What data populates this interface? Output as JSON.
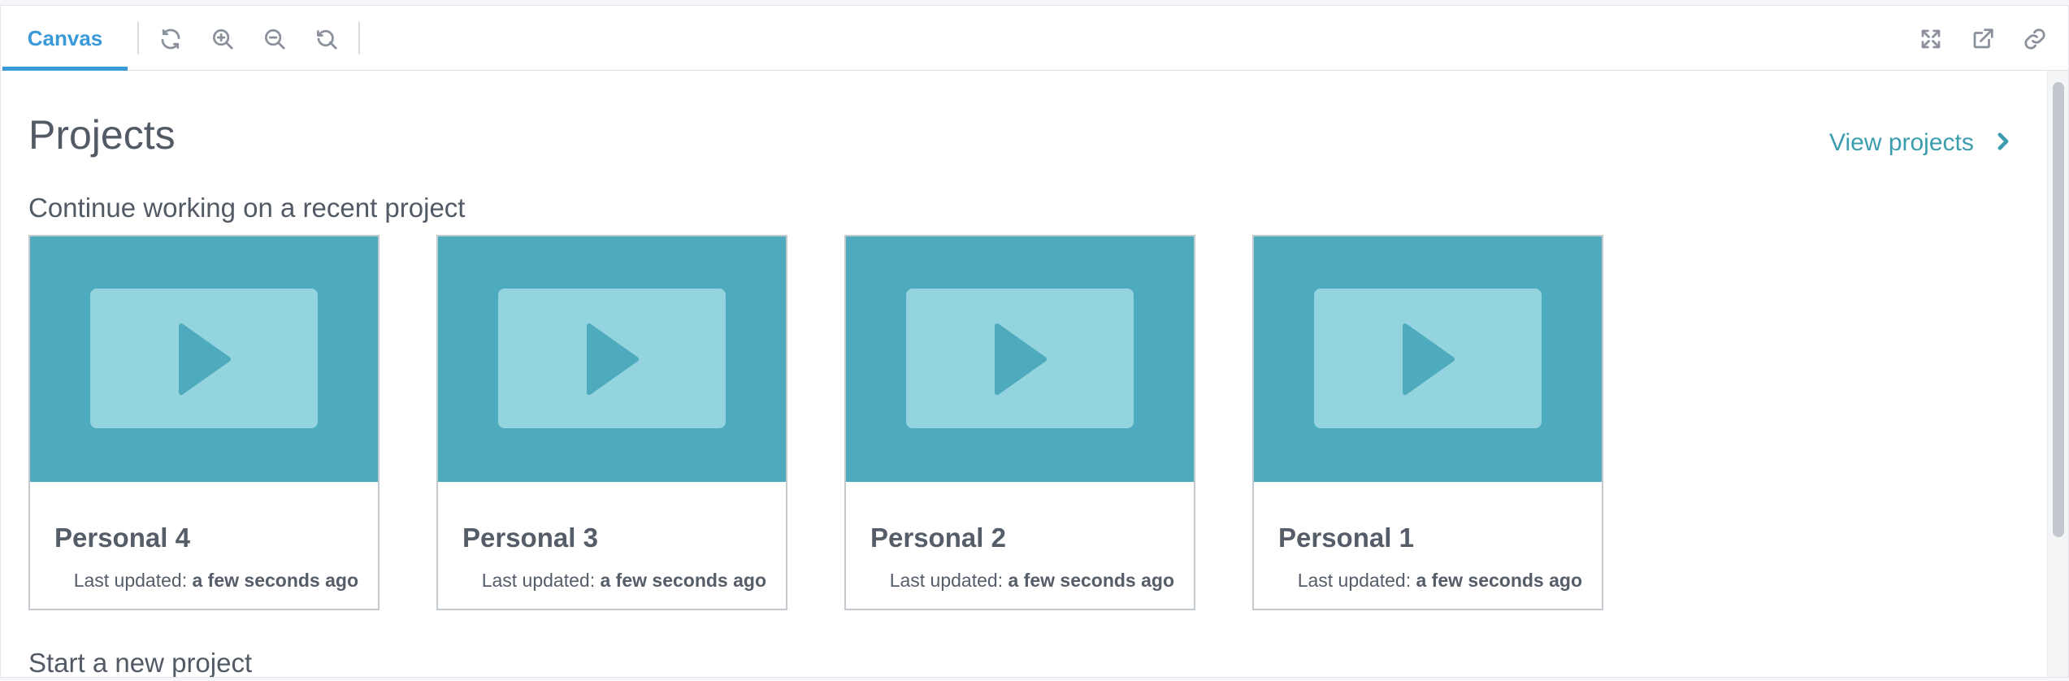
{
  "toolbar": {
    "tab_label": "Canvas",
    "left_icons": [
      "refresh-icon",
      "zoom-in-icon",
      "zoom-out-icon",
      "reset-zoom-icon"
    ],
    "right_icons": [
      "fullscreen-icon",
      "open-external-icon",
      "link-icon"
    ]
  },
  "header": {
    "title": "Projects",
    "view_projects_label": "View projects"
  },
  "sections": {
    "recent_title": "Continue working on a recent project",
    "new_title": "Start a new project"
  },
  "projects": [
    {
      "name": "Personal 4",
      "updated_label": "Last updated:",
      "updated_value": "a few seconds ago"
    },
    {
      "name": "Personal 3",
      "updated_label": "Last updated:",
      "updated_value": "a few seconds ago"
    },
    {
      "name": "Personal 2",
      "updated_label": "Last updated:",
      "updated_value": "a few seconds ago"
    },
    {
      "name": "Personal 1",
      "updated_label": "Last updated:",
      "updated_value": "a few seconds ago"
    }
  ],
  "colors": {
    "accent": "#3a9ad9",
    "link": "#3c9dae",
    "thumbnail_bg": "#4eaabd",
    "thumbnail_screen": "#94d4de"
  }
}
